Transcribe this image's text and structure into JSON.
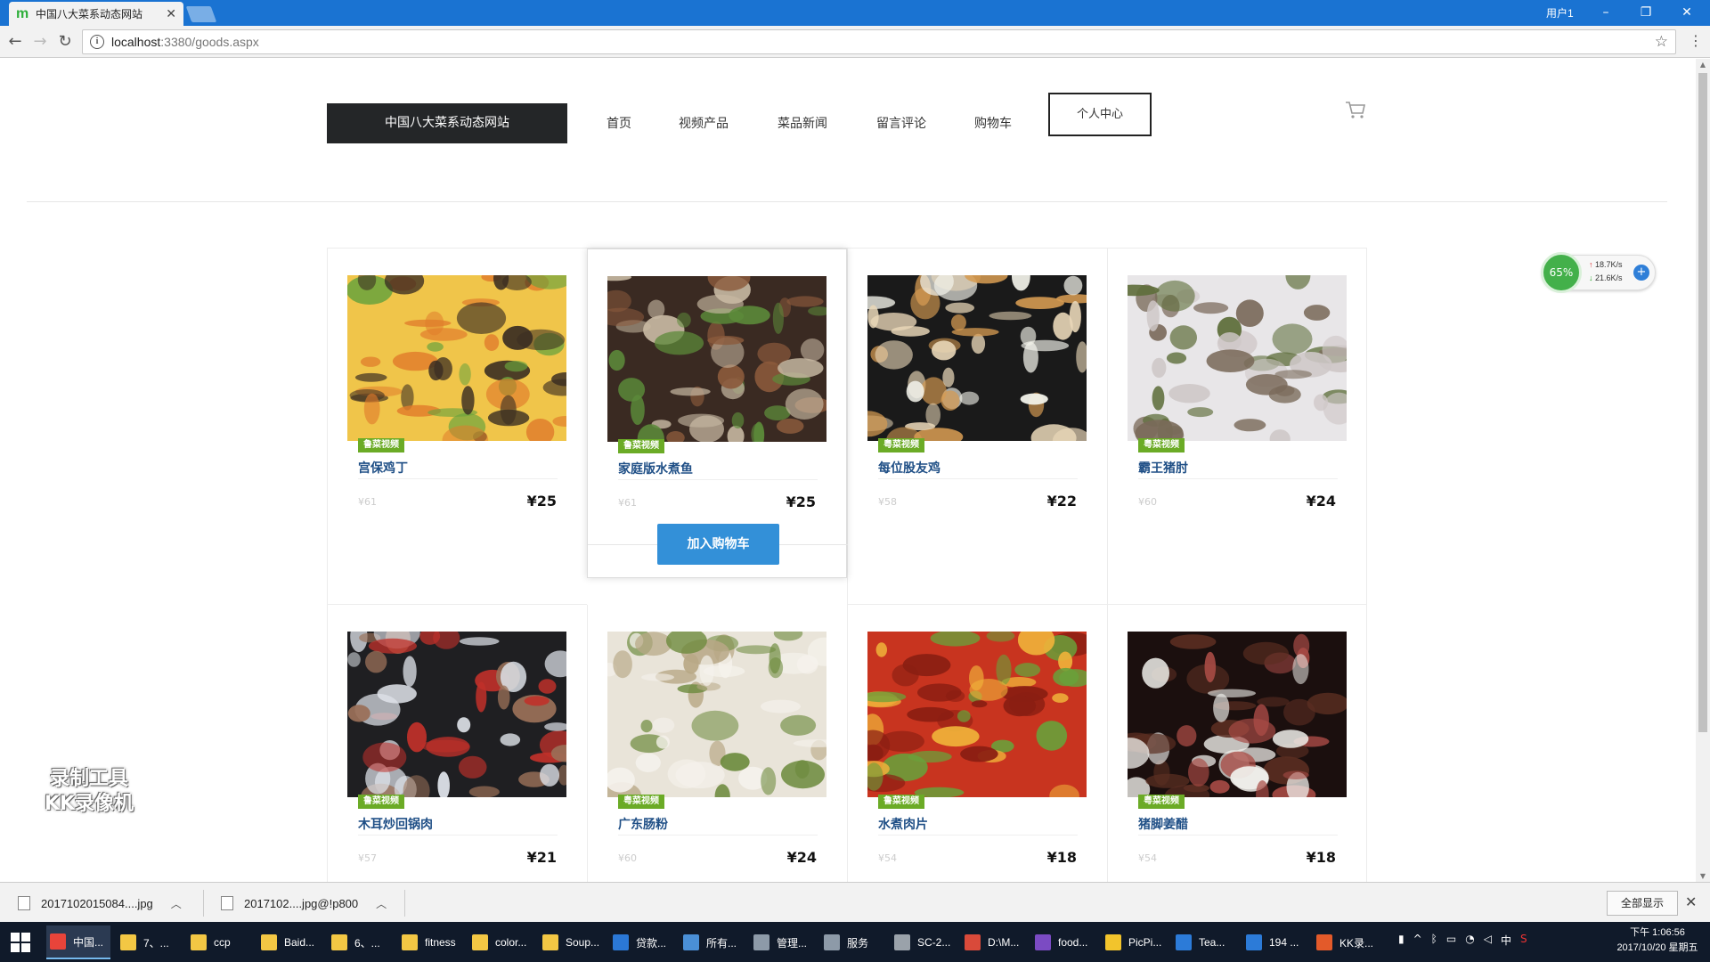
{
  "browser": {
    "tab_title": "中国八大菜系动态网站",
    "favicon_letter": "m",
    "window_user": "用户1",
    "url_host": "localhost",
    "url_rest": ":3380/goods.aspx"
  },
  "site": {
    "brand": "中国八大菜系动态网站",
    "nav": [
      "首页",
      "视频产品",
      "菜品新闻",
      "留言评论",
      "购物车"
    ],
    "personal": "个人中心",
    "add_to_cart": "加入购物车"
  },
  "products": [
    {
      "tag": "鲁菜视频",
      "name": "宫保鸡丁",
      "old": "¥61",
      "price": "¥25",
      "palette": [
        "#f0c54a",
        "#3a2d22",
        "#6aa33d",
        "#e07b2b"
      ]
    },
    {
      "tag": "鲁菜视频",
      "name": "家庭版水煮鱼",
      "old": "¥61",
      "price": "¥25",
      "palette": [
        "#3a2a22",
        "#8b5a3c",
        "#c8b9a3",
        "#5c8a3a"
      ]
    },
    {
      "tag": "粤菜视频",
      "name": "每位股友鸡",
      "old": "¥58",
      "price": "¥22",
      "palette": [
        "#1a1a1a",
        "#e9d7b8",
        "#d69b52",
        "#f2f2ea"
      ]
    },
    {
      "tag": "粤菜视频",
      "name": "霸王猪肘",
      "old": "¥60",
      "price": "¥24",
      "palette": [
        "#e8e6e8",
        "#7a6a5a",
        "#5f6f3c",
        "#cfc8c8"
      ]
    },
    {
      "tag": "鲁菜视频",
      "name": "木耳炒回锅肉",
      "old": "¥57",
      "price": "¥21",
      "palette": [
        "#1f1f22",
        "#dfe3ea",
        "#9a7058",
        "#c0302a"
      ]
    },
    {
      "tag": "粤菜视频",
      "name": "广东肠粉",
      "old": "¥60",
      "price": "¥24",
      "palette": [
        "#e9e4d9",
        "#b8a886",
        "#6c8a3c",
        "#f5f2ec"
      ]
    },
    {
      "tag": "鲁菜视频",
      "name": "水煮肉片",
      "old": "¥54",
      "price": "¥18",
      "palette": [
        "#c8341f",
        "#f0b23a",
        "#6aa03a",
        "#8a1e12"
      ]
    },
    {
      "tag": "粤菜视频",
      "name": "猪脚姜醋",
      "old": "¥54",
      "price": "¥18",
      "palette": [
        "#1b0f0e",
        "#5b2e22",
        "#a84b45",
        "#efeeea"
      ]
    }
  ],
  "speed": {
    "percent": "65%",
    "up": "18.7K/s",
    "down": "21.6K/s"
  },
  "watermark": [
    "录制工具",
    "KK录像机"
  ],
  "downloads": {
    "items": [
      "2017102015084....jpg",
      "2017102....jpg@!p800"
    ],
    "show_all": "全部显示"
  },
  "taskbar": {
    "tasks": [
      {
        "label": "中国...",
        "color": "#e8443a"
      },
      {
        "label": "7、...",
        "color": "#f3c744"
      },
      {
        "label": "ccp",
        "color": "#f3c744"
      },
      {
        "label": "Baid...",
        "color": "#f3c744"
      },
      {
        "label": "6、...",
        "color": "#f3c744"
      },
      {
        "label": "fitness",
        "color": "#f3c744"
      },
      {
        "label": "color...",
        "color": "#f3c744"
      },
      {
        "label": "Soup...",
        "color": "#f3c744"
      },
      {
        "label": "贷款...",
        "color": "#2b78d6"
      },
      {
        "label": "所有...",
        "color": "#4a8fd6"
      },
      {
        "label": "管理...",
        "color": "#8d9aa8"
      },
      {
        "label": "服务",
        "color": "#8d9aa8"
      },
      {
        "label": "SC-2...",
        "color": "#9aa2aa"
      },
      {
        "label": "D:\\M...",
        "color": "#d94a3a"
      },
      {
        "label": "food...",
        "color": "#7b4bc3"
      },
      {
        "label": "PicPi...",
        "color": "#f2c42c"
      },
      {
        "label": "Tea...",
        "color": "#2c7bd8"
      },
      {
        "label": "194 ...",
        "color": "#2c7bd8"
      },
      {
        "label": "KK录...",
        "color": "#e35a2a"
      }
    ],
    "tray_ime": "中",
    "time": "下午 1:06:56",
    "date": "2017/10/20 星期五"
  }
}
